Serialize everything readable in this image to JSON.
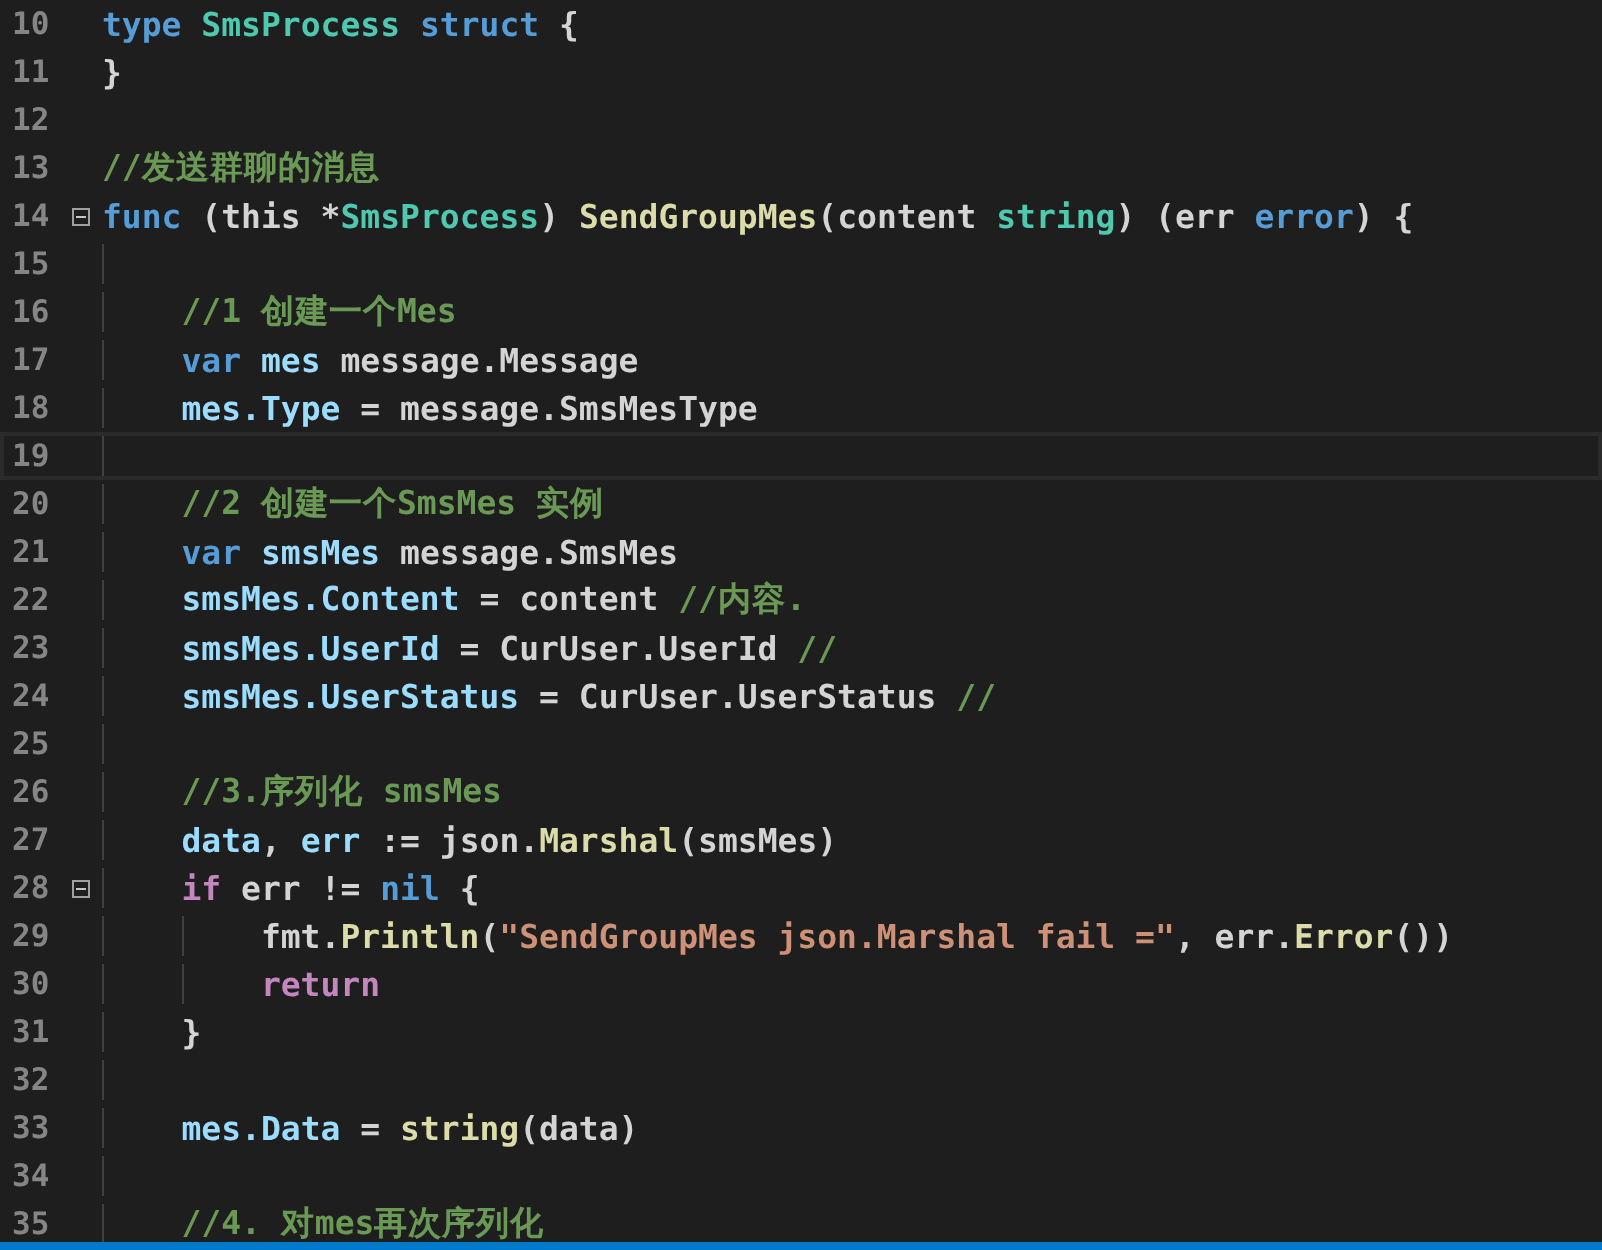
{
  "editor": {
    "lines": [
      {
        "number": "10",
        "tokens": [
          {
            "text": "type ",
            "kind": "keyword"
          },
          {
            "text": "SmsProcess ",
            "kind": "type"
          },
          {
            "text": "struct ",
            "kind": "keyword"
          },
          {
            "text": "{",
            "kind": "plain"
          }
        ]
      },
      {
        "number": "11",
        "tokens": [
          {
            "text": "}",
            "kind": "plain"
          }
        ]
      },
      {
        "number": "12"
      },
      {
        "number": "13",
        "tokens": [
          {
            "text": "//发送群聊的消息",
            "kind": "comment"
          }
        ]
      },
      {
        "number": "14",
        "fold": true,
        "tokens": [
          {
            "text": "func",
            "kind": "keyword"
          },
          {
            "text": " (this *",
            "kind": "plain"
          },
          {
            "text": "SmsProcess",
            "kind": "type"
          },
          {
            "text": ") ",
            "kind": "plain"
          },
          {
            "text": "SendGroupMes",
            "kind": "function"
          },
          {
            "text": "(content ",
            "kind": "plain"
          },
          {
            "text": "string",
            "kind": "type"
          },
          {
            "text": ") (err ",
            "kind": "plain"
          },
          {
            "text": "error",
            "kind": "keyword"
          },
          {
            "text": ") {",
            "kind": "plain"
          }
        ],
        "children": [
          {
            "number": "15"
          },
          {
            "number": "16",
            "tokens": [
              {
                "text": "//1 创建一个Mes",
                "kind": "comment"
              }
            ]
          },
          {
            "number": "17",
            "tokens": [
              {
                "text": "var ",
                "kind": "keyword"
              },
              {
                "text": "mes",
                "kind": "variable"
              },
              {
                "text": " message.Message",
                "kind": "plain"
              }
            ]
          },
          {
            "number": "18",
            "tokens": [
              {
                "text": "mes.Type",
                "kind": "variable"
              },
              {
                "text": " = message.SmsMesType",
                "kind": "plain"
              }
            ]
          },
          {
            "number": "19",
            "current": true
          },
          {
            "number": "20",
            "tokens": [
              {
                "text": "//2 创建一个SmsMes 实例",
                "kind": "comment"
              }
            ]
          },
          {
            "number": "21",
            "tokens": [
              {
                "text": "var ",
                "kind": "keyword"
              },
              {
                "text": "smsMes",
                "kind": "variable"
              },
              {
                "text": " message.SmsMes",
                "kind": "plain"
              }
            ]
          },
          {
            "number": "22",
            "tokens": [
              {
                "text": "smsMes.Content",
                "kind": "variable"
              },
              {
                "text": " = content ",
                "kind": "plain"
              },
              {
                "text": "//内容.",
                "kind": "comment"
              }
            ]
          },
          {
            "number": "23",
            "tokens": [
              {
                "text": "smsMes.UserId",
                "kind": "variable"
              },
              {
                "text": " = CurUser.UserId ",
                "kind": "plain"
              },
              {
                "text": "//",
                "kind": "comment"
              }
            ]
          },
          {
            "number": "24",
            "tokens": [
              {
                "text": "smsMes.UserStatus",
                "kind": "variable"
              },
              {
                "text": " = CurUser.UserStatus ",
                "kind": "plain"
              },
              {
                "text": "//",
                "kind": "comment"
              }
            ]
          },
          {
            "number": "25"
          },
          {
            "number": "26",
            "tokens": [
              {
                "text": "//3.序列化 smsMes",
                "kind": "comment"
              }
            ]
          },
          {
            "number": "27",
            "tokens": [
              {
                "text": "data",
                "kind": "variable"
              },
              {
                "text": ", ",
                "kind": "plain"
              },
              {
                "text": "err",
                "kind": "variable"
              },
              {
                "text": " := json.",
                "kind": "plain"
              },
              {
                "text": "Marshal",
                "kind": "function"
              },
              {
                "text": "(smsMes)",
                "kind": "plain"
              }
            ]
          },
          {
            "number": "28",
            "fold": true,
            "tokens": [
              {
                "text": "if",
                "kind": "control"
              },
              {
                "text": " err != ",
                "kind": "plain"
              },
              {
                "text": "nil",
                "kind": "keyword"
              },
              {
                "text": " {",
                "kind": "plain"
              }
            ],
            "children": [
              {
                "number": "29",
                "tokens": [
                  {
                    "text": "fmt.",
                    "kind": "plain"
                  },
                  {
                    "text": "Println",
                    "kind": "function"
                  },
                  {
                    "text": "(",
                    "kind": "plain"
                  },
                  {
                    "text": "\"SendGroupMes json.Marshal fail =\"",
                    "kind": "string"
                  },
                  {
                    "text": ", err.",
                    "kind": "plain"
                  },
                  {
                    "text": "Error",
                    "kind": "function"
                  },
                  {
                    "text": "())",
                    "kind": "plain"
                  }
                ]
              },
              {
                "number": "30",
                "tokens": [
                  {
                    "text": "return",
                    "kind": "control"
                  }
                ]
              }
            ]
          },
          {
            "number": "31",
            "tokens": [
              {
                "text": "}",
                "kind": "plain"
              }
            ]
          },
          {
            "number": "32"
          },
          {
            "number": "33",
            "tokens": [
              {
                "text": "mes.Data",
                "kind": "variable"
              },
              {
                "text": " = ",
                "kind": "plain"
              },
              {
                "text": "string",
                "kind": "function"
              },
              {
                "text": "(data)",
                "kind": "plain"
              }
            ]
          },
          {
            "number": "34"
          },
          {
            "number": "35",
            "tokens": [
              {
                "text": "//4. 对mes再次序列化",
                "kind": "comment"
              }
            ]
          }
        ]
      }
    ]
  }
}
